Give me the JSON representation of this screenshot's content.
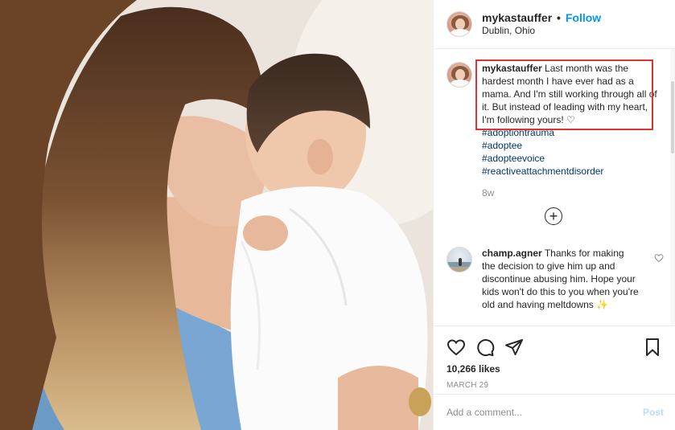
{
  "post": {
    "username": "mykastauffer",
    "follow_label": "Follow",
    "location": "Dublin, Ohio",
    "caption_text": "Last month was the hardest month I have ever had as a mama. And I'm still working through all of it. But instead of leading with my heart, I'm following yours! ♡",
    "hashtags": [
      "#adoptiontrauma",
      "#adoptee",
      "#adopteevoice",
      "#reactiveattachmentdisorder"
    ],
    "age": "8w",
    "likes": "10,266 likes",
    "date": "MARCH 29"
  },
  "comment": {
    "username": "champ.agner",
    "text": "Thanks for making the decision to give him up and discontinue abusing him. Hope your kids won't do this to you when you're old and having meltdowns ✨"
  },
  "composer": {
    "placeholder": "Add a comment...",
    "post_label": "Post"
  },
  "colors": {
    "follow": "#0095f6",
    "highlight": "#e53030",
    "hashtag": "#00376b",
    "post_disabled": "#b2dffc"
  }
}
